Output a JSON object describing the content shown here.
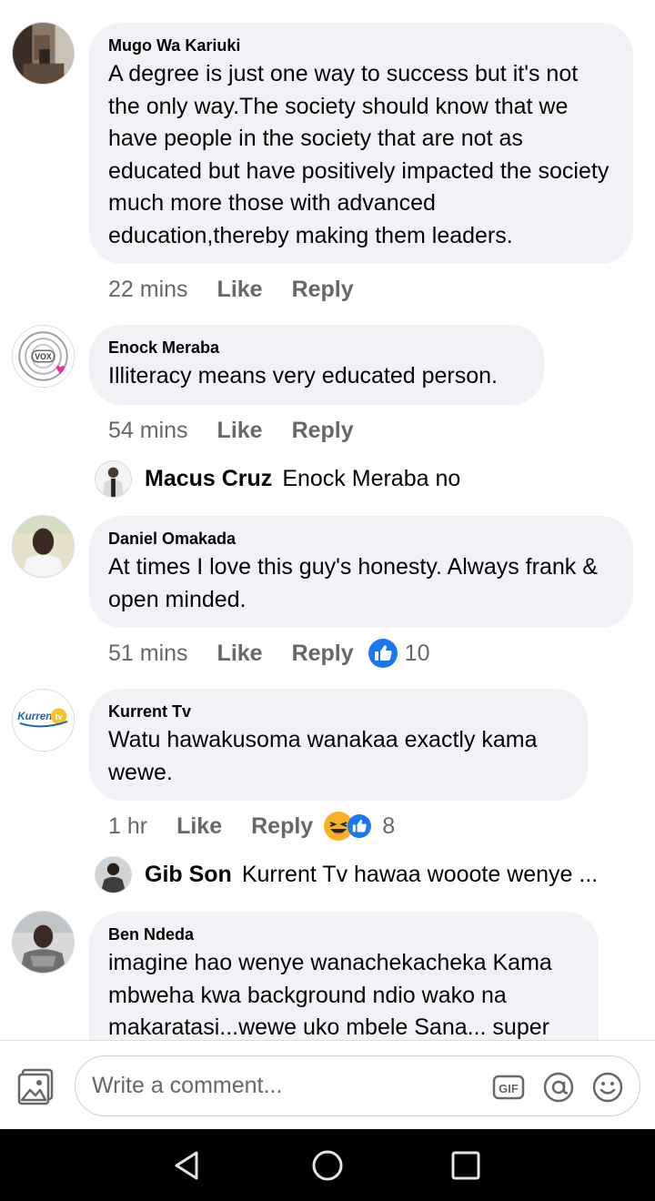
{
  "comments": [
    {
      "author": "Mugo Wa Kariuki",
      "text": "A degree is just one way to success but it's not the only way.The society should know that we have people in the society that are not as educated but have positively impacted the society much more those with advanced education,thereby making them leaders.",
      "time": "22 mins",
      "like_label": "Like",
      "reply_label": "Reply"
    },
    {
      "author": "Enock Meraba",
      "text": "Illiteracy means very educated person.",
      "time": "54 mins",
      "like_label": "Like",
      "reply_label": "Reply",
      "avatar_caption": "VOX",
      "reply_preview": {
        "author": "Macus Cruz",
        "text": "Enock Meraba no"
      }
    },
    {
      "author": "Daniel Omakada",
      "text": "At times I love this guy's honesty. Always frank & open minded.",
      "time": "51 mins",
      "like_label": "Like",
      "reply_label": "Reply",
      "reaction_count": "10",
      "reaction_icons": [
        "like-reaction-icon"
      ]
    },
    {
      "author": "Kurrent Tv",
      "text": "Watu hawakusoma wanakaa exactly kama wewe.",
      "time": "1 hr",
      "like_label": "Like",
      "reply_label": "Reply",
      "reaction_count": "8",
      "reaction_icons": [
        "haha-reaction-icon",
        "like-reaction-icon"
      ],
      "avatar_caption": "Kurrent",
      "avatar_badge": "tv",
      "reply_preview": {
        "author": "Gib Son",
        "text": "Kurrent Tv hawaa wooote wenye ..."
      }
    },
    {
      "author": "Ben Ndeda",
      "text": "imagine hao wenye wanachekacheka Kama mbweha  kwa background ndio wako na makaratasi...wewe uko mbele Sana... super"
    }
  ],
  "composer": {
    "placeholder": "Write a comment...",
    "gif_label": "GIF",
    "icons": [
      "photo-icon",
      "gif-icon",
      "mention-icon",
      "emoji-icon"
    ]
  },
  "colors": {
    "bubble": "#f0f2f5",
    "meta_text": "#65676b",
    "like_blue": "#1877f2",
    "haha_yellow": "#f7b125",
    "navbar": "#000000"
  }
}
